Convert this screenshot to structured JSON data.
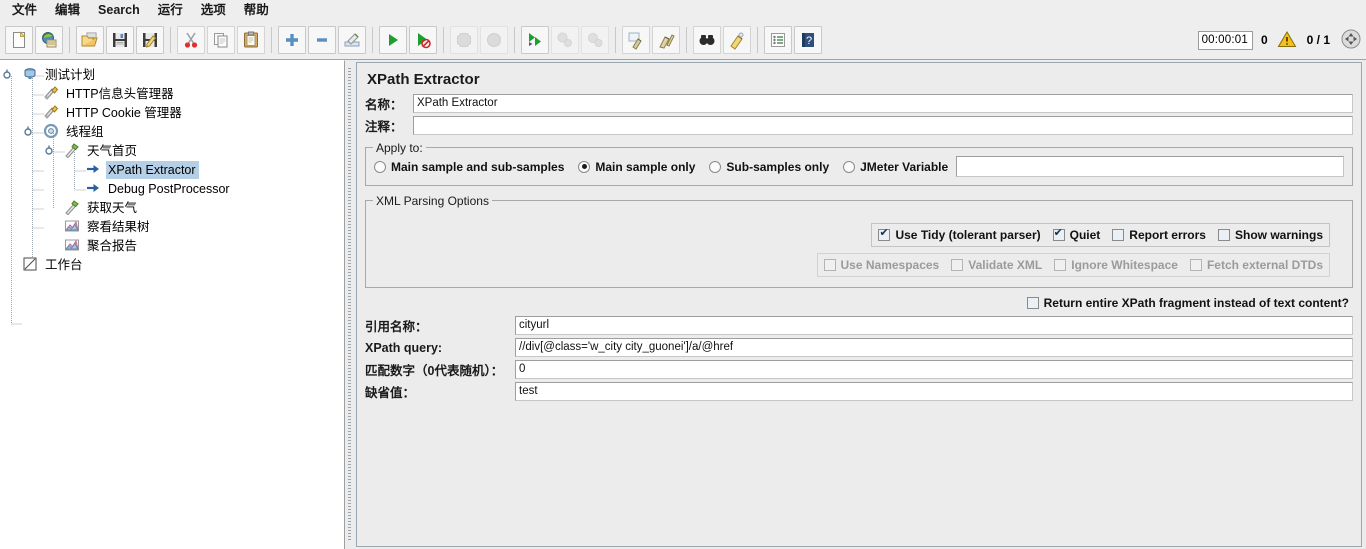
{
  "window": {
    "menu": [
      {
        "label": "文件",
        "name": "menu-file"
      },
      {
        "label": "编辑",
        "name": "menu-edit"
      },
      {
        "label": "Search",
        "name": "menu-search"
      },
      {
        "label": "运行",
        "name": "menu-run"
      },
      {
        "label": "选项",
        "name": "menu-options"
      },
      {
        "label": "帮助",
        "name": "menu-help"
      }
    ]
  },
  "toolbar": {
    "icons": [
      {
        "name": "new-icon",
        "label": "New"
      },
      {
        "name": "templates-icon",
        "label": "Templates"
      },
      {
        "name": "open-icon",
        "label": "Open"
      },
      {
        "name": "save-icon",
        "label": "Save"
      },
      {
        "name": "save-as-icon",
        "label": "Save as"
      },
      {
        "name": "cut-icon",
        "label": "Cut"
      },
      {
        "name": "copy-icon",
        "label": "Copy"
      },
      {
        "name": "paste-icon",
        "label": "Paste"
      },
      {
        "name": "expand-icon",
        "label": "Expand all"
      },
      {
        "name": "collapse-icon",
        "label": "Collapse all"
      },
      {
        "name": "toggle-icon",
        "label": "Toggle"
      },
      {
        "name": "start-icon",
        "label": "Start"
      },
      {
        "name": "start-no-pauses-icon",
        "label": "Start no pauses"
      },
      {
        "name": "stop-icon",
        "label": "Stop"
      },
      {
        "name": "shutdown-icon",
        "label": "Shutdown"
      },
      {
        "name": "start-remote-icon",
        "label": "Remote start all"
      },
      {
        "name": "stop-remote-icon",
        "label": "Remote stop all"
      },
      {
        "name": "shutdown-remote-icon",
        "label": "Remote shutdown all"
      },
      {
        "name": "clear-icon",
        "label": "Clear"
      },
      {
        "name": "clear-all-icon",
        "label": "Clear all"
      },
      {
        "name": "search-icon",
        "label": "Search"
      },
      {
        "name": "reset-search-icon",
        "label": "Reset search"
      },
      {
        "name": "function-helper-icon",
        "label": "Function helper dialog"
      },
      {
        "name": "help-icon",
        "label": "Help"
      }
    ],
    "status": {
      "timer": "00:00:01",
      "warning_count": "0",
      "warning_icon": "warning-triangle-icon",
      "threads": "0 / 1",
      "gear_icon": "connection-icon"
    }
  },
  "tree": {
    "nodes": [
      {
        "label": "测试计划",
        "depth": 0,
        "icon": "test-plan-icon",
        "handle": "expanded",
        "selected": false
      },
      {
        "label": "HTTP信息头管理器",
        "depth": 1,
        "icon": "header-manager-icon",
        "handle": "none",
        "selected": false
      },
      {
        "label": "HTTP Cookie 管理器",
        "depth": 1,
        "icon": "cookie-manager-icon",
        "handle": "none",
        "selected": false
      },
      {
        "label": "线程组",
        "depth": 1,
        "icon": "thread-group-icon",
        "handle": "expanded",
        "selected": false
      },
      {
        "label": "天气首页",
        "depth": 2,
        "icon": "http-sampler-icon",
        "handle": "expanded",
        "selected": false
      },
      {
        "label": "XPath Extractor",
        "depth": 3,
        "icon": "post-processor-icon",
        "handle": "none",
        "selected": true
      },
      {
        "label": "Debug PostProcessor",
        "depth": 3,
        "icon": "post-processor-icon",
        "handle": "none",
        "selected": false
      },
      {
        "label": "获取天气",
        "depth": 2,
        "icon": "http-sampler-icon",
        "handle": "none",
        "selected": false
      },
      {
        "label": "察看结果树",
        "depth": 2,
        "icon": "listener-icon",
        "handle": "none",
        "selected": false
      },
      {
        "label": "聚合报告",
        "depth": 2,
        "icon": "listener-icon",
        "handle": "none",
        "selected": false
      },
      {
        "label": "工作台",
        "depth": 0,
        "icon": "workbench-icon",
        "handle": "none",
        "selected": false
      }
    ]
  },
  "panel": {
    "title": "XPath Extractor",
    "name_label": "名称：",
    "name_value": "XPath Extractor",
    "comment_label": "注释：",
    "comment_value": "",
    "apply_to": {
      "title": "Apply to:",
      "options": [
        {
          "label": "Main sample and sub-samples",
          "selected": false
        },
        {
          "label": "Main sample only",
          "selected": true
        },
        {
          "label": "Sub-samples only",
          "selected": false
        },
        {
          "label": "JMeter Variable",
          "selected": false
        }
      ],
      "variable_value": ""
    },
    "xml_parsing": {
      "title": "XML Parsing Options",
      "row1": [
        {
          "label": "Use Tidy (tolerant parser)",
          "checked": true,
          "enabled": true
        },
        {
          "label": "Quiet",
          "checked": true,
          "enabled": true
        },
        {
          "label": "Report errors",
          "checked": false,
          "enabled": true
        },
        {
          "label": "Show warnings",
          "checked": false,
          "enabled": true
        }
      ],
      "row2": [
        {
          "label": "Use Namespaces",
          "checked": false,
          "enabled": false
        },
        {
          "label": "Validate XML",
          "checked": false,
          "enabled": false
        },
        {
          "label": "Ignore Whitespace",
          "checked": false,
          "enabled": false
        },
        {
          "label": "Fetch external DTDs",
          "checked": false,
          "enabled": false
        }
      ]
    },
    "return_fragment": {
      "label": "Return entire XPath fragment instead of text content?",
      "checked": false
    },
    "fields": [
      {
        "label": "引用名称：",
        "value": "cityurl",
        "name": "reference-name"
      },
      {
        "label": "XPath query:",
        "value": "//div[@class='w_city city_guonei']/a/@href",
        "name": "xpath-query"
      },
      {
        "label": "匹配数字（0代表随机）：",
        "value": "0",
        "name": "match-number"
      },
      {
        "label": "缺省值：",
        "value": "test",
        "name": "default-value"
      }
    ]
  },
  "colors": {
    "window_bg": "#ececec",
    "panel_bg": "#ececec",
    "tree_bg": "#ffffff",
    "selection": "#b5cfe7",
    "field_bg": "#ffffff",
    "border": "#9aa7b0",
    "disabled_text": "#9b9b9b"
  }
}
